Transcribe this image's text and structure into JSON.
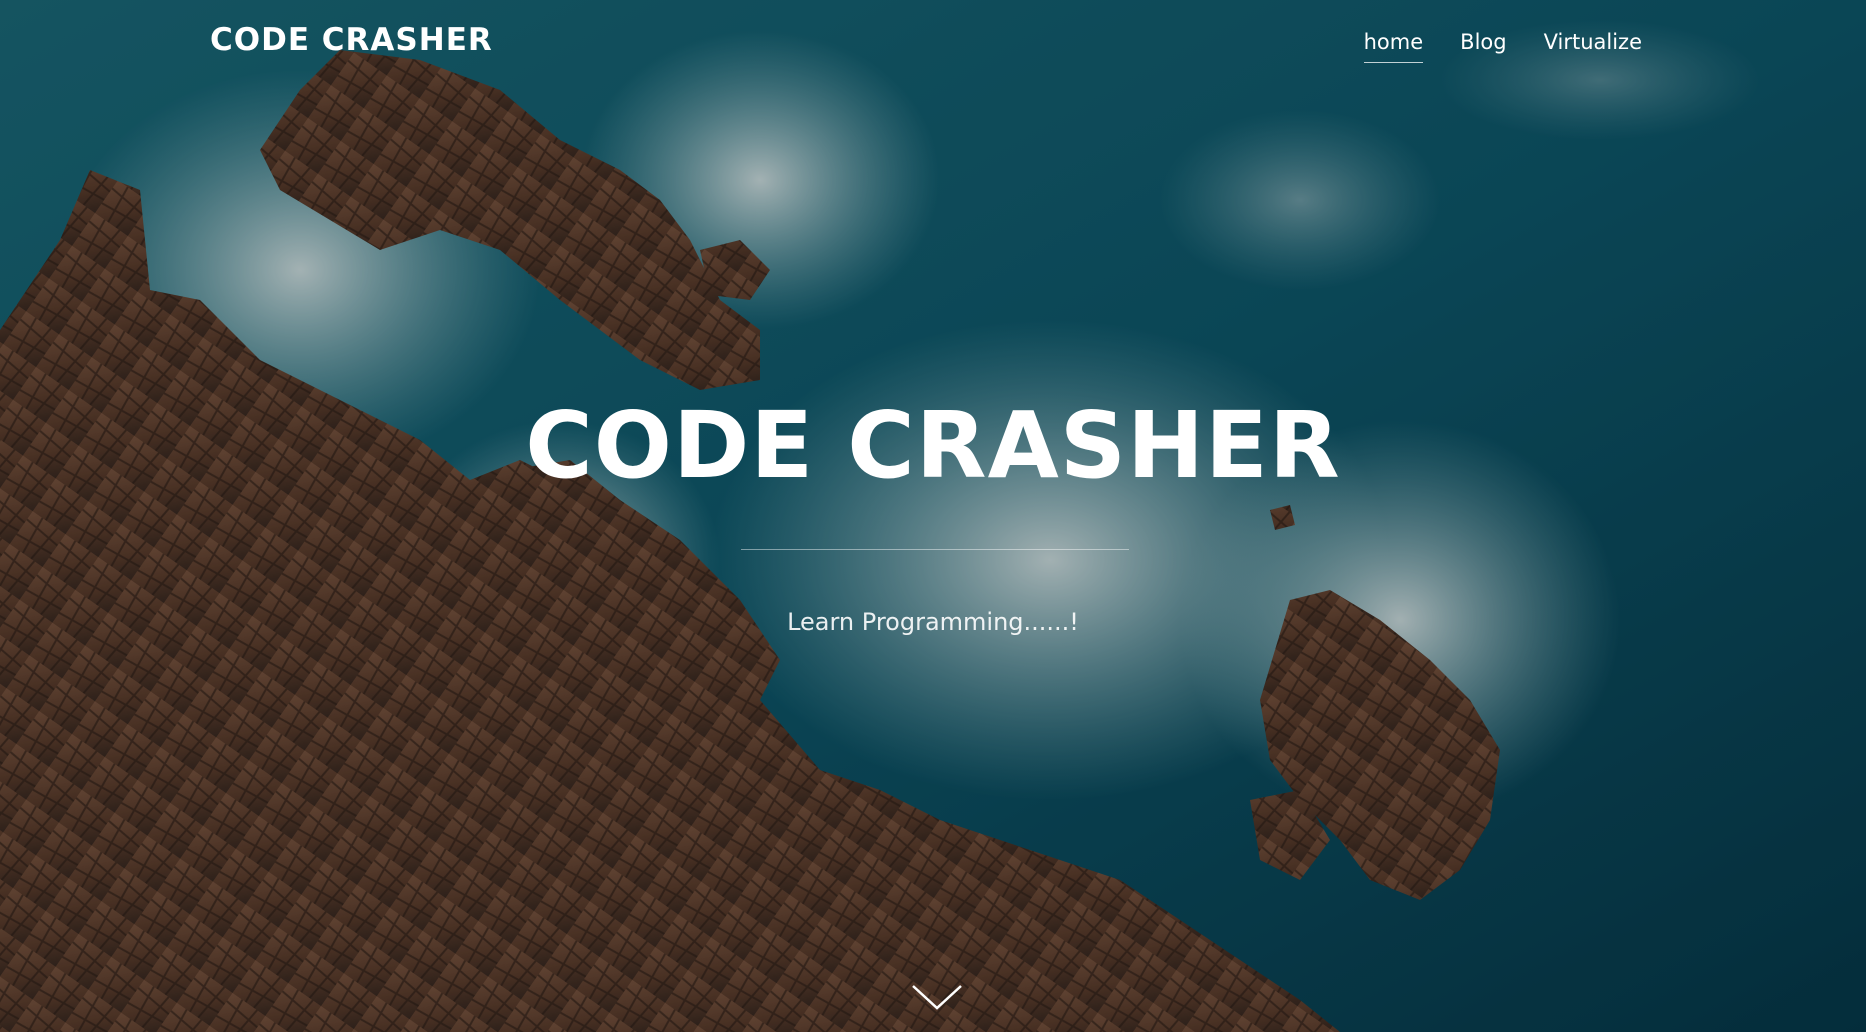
{
  "nav": {
    "brand": "CODE CRASHER",
    "links": [
      {
        "label": "home",
        "active": true
      },
      {
        "label": "Blog",
        "active": false
      },
      {
        "label": "Virtualize",
        "active": false
      }
    ]
  },
  "hero": {
    "title": "CODE CRASHER",
    "subtitle": "Learn Programming......!",
    "background": "aerial-coastline-rocks-ocean",
    "scroll_icon": "chevron-down-icon"
  },
  "colors": {
    "ocean": "#0e5a6e",
    "rock": "#6b4a38",
    "foam": "#e6f2f2",
    "text": "#ffffff"
  }
}
